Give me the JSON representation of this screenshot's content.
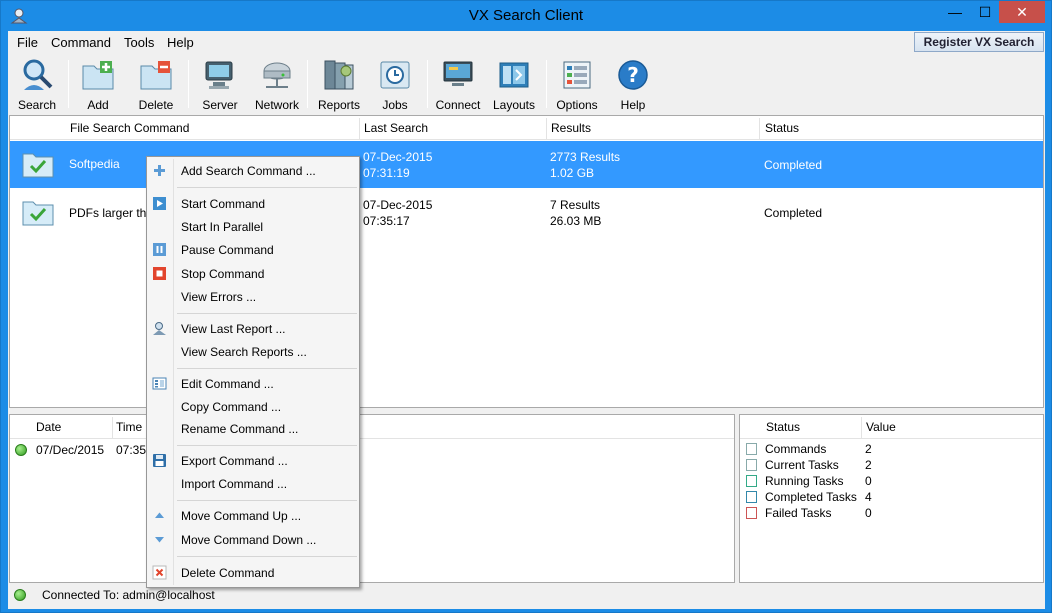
{
  "window": {
    "title": "VX Search Client",
    "controls": {
      "minimize": "—",
      "maximize": "☐",
      "close": "✕"
    }
  },
  "menubar": {
    "items": [
      "File",
      "Command",
      "Tools",
      "Help"
    ],
    "register": "Register VX Search"
  },
  "toolbar": {
    "buttons": [
      {
        "label": "Search",
        "icon": "search-icon"
      },
      {
        "label": "Add",
        "icon": "add-folder-icon"
      },
      {
        "label": "Delete",
        "icon": "delete-folder-icon"
      },
      {
        "label": "Server",
        "icon": "server-icon"
      },
      {
        "label": "Network",
        "icon": "network-icon"
      },
      {
        "label": "Reports",
        "icon": "reports-icon"
      },
      {
        "label": "Jobs",
        "icon": "jobs-icon"
      },
      {
        "label": "Connect",
        "icon": "connect-icon"
      },
      {
        "label": "Layouts",
        "icon": "layouts-icon"
      },
      {
        "label": "Options",
        "icon": "options-icon"
      },
      {
        "label": "Help",
        "icon": "help-icon"
      }
    ]
  },
  "commands": {
    "headers": [
      "File Search Command",
      "Last Search",
      "Results",
      "Status"
    ],
    "rows": [
      {
        "name": "Softpedia",
        "date": "07-Dec-2015",
        "time": "07:31:19",
        "results": "2773 Results",
        "size": "1.02 GB",
        "status": "Completed",
        "selected": true
      },
      {
        "name": "PDFs larger tha",
        "date": "07-Dec-2015",
        "time": "07:35:17",
        "results": "7 Results",
        "size": "26.03 MB",
        "status": "Completed",
        "selected": false
      }
    ]
  },
  "log": {
    "headers": [
      "Date",
      "Time"
    ],
    "rows": [
      {
        "date": "07/Dec/2015",
        "time": "07:35:"
      }
    ]
  },
  "stats": {
    "headers": [
      "Status",
      "Value"
    ],
    "rows": [
      {
        "label": "Commands",
        "value": "2"
      },
      {
        "label": "Current Tasks",
        "value": "2"
      },
      {
        "label": "Running Tasks",
        "value": "0"
      },
      {
        "label": "Completed Tasks",
        "value": "4"
      },
      {
        "label": "Failed Tasks",
        "value": "0"
      }
    ]
  },
  "statusbar": {
    "text": "Connected To: admin@localhost"
  },
  "context_menu": {
    "items": [
      {
        "label": "Add Search Command ...",
        "icon": "plus-icon"
      },
      {
        "label": "Start Command",
        "icon": "play-icon"
      },
      {
        "label": "Start In Parallel",
        "icon": ""
      },
      {
        "label": "Pause Command",
        "icon": "pause-icon"
      },
      {
        "label": "Stop Command",
        "icon": "stop-icon"
      },
      {
        "label": "View Errors ...",
        "icon": ""
      },
      {
        "label": "View Last Report ...",
        "icon": "report-icon"
      },
      {
        "label": "View Search Reports ...",
        "icon": ""
      },
      {
        "label": "Edit Command ...",
        "icon": "edit-icon"
      },
      {
        "label": "Copy Command ...",
        "icon": ""
      },
      {
        "label": "Rename Command ...",
        "icon": ""
      },
      {
        "label": "Export Command ...",
        "icon": "save-icon"
      },
      {
        "label": "Import Command ...",
        "icon": ""
      },
      {
        "label": "Move Command Up ...",
        "icon": "arrow-up-icon"
      },
      {
        "label": "Move Command Down ...",
        "icon": "arrow-down-icon"
      },
      {
        "label": "Delete Command",
        "icon": "delete-icon"
      }
    ]
  },
  "colors": {
    "title_bar": "#1c8ce6",
    "selection": "#3399ff",
    "close_button": "#c7504a",
    "status_ok": "#2f9a1e"
  }
}
